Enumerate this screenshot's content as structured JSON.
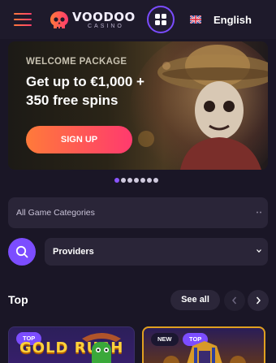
{
  "header": {
    "logo_word": "VOODOO",
    "logo_sub": "CASINO",
    "language": "English",
    "flag_icon": "uk-flag-icon",
    "menu_icon": "hamburger-icon",
    "games_icon": "grid-icon"
  },
  "banner": {
    "kicker": "WELCOME PACKAGE",
    "title": "Get up to €1,000 + 350 free spins",
    "cta": "SIGN UP"
  },
  "carousel": {
    "slides": 7,
    "active": 1
  },
  "filters": {
    "categories_label": "All Game Categories",
    "providers_label": "Providers",
    "search_icon": "search-icon"
  },
  "section": {
    "title": "Top",
    "see_all": "See all"
  },
  "cards": [
    {
      "badges": [
        "TOP"
      ],
      "title": "GOLD RUSH"
    },
    {
      "badges": [
        "NEW",
        "TOP"
      ],
      "title": ""
    }
  ],
  "colors": {
    "accent": "#7c4dff",
    "cta_start": "#ff7a3a",
    "cta_end": "#ff3a6e",
    "background": "#1a1626"
  }
}
